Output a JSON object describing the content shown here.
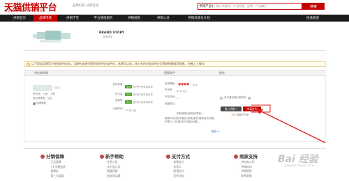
{
  "header": {
    "logo_cn": "天猫供销平台",
    "logo_en": "GONGXIAO.TMALL.COM",
    "slogan": "品牌好货 分销首选",
    "search_category": "供销产品",
    "search_placeholder": "输入关键字，产品标题、品牌、产品编号",
    "search_button": "搜索"
  },
  "nav": {
    "items": [
      "供销首页",
      "品牌市场",
      "供销学堂",
      "平台增值服务",
      "供销规则",
      "供销入驻",
      "供销商成长计划"
    ],
    "active_index": 1,
    "right_link": "快速通道"
  },
  "store": {
    "title": "BRAND STORY",
    "subtitle": "品牌故事"
  },
  "notice": {
    "text": "以下是该品牌官方授权的供应商，当期有关键分销资质的供应商合作，选择可以的...线上布供应面对供应可直接到微推荐销售，完善之上操作"
  },
  "table": {
    "headers": [
      "供应商明细",
      "",
      "招募条件",
      "操作"
    ],
    "supplier": {
      "location": "所在地：上海，上海",
      "brand_type": "供应商类型：企业",
      "badge": "品牌旗舰"
    },
    "stats": [
      {
        "label": "供货质量：",
        "tag": "5.0",
        "note": "低于行业平均水平"
      },
      {
        "label": "成交量：",
        "tag": "5.0",
        "note": "低于行业平均水平"
      },
      {
        "label": "退款率：",
        "tag": "5.0",
        "note": "低于行业平均水平"
      },
      {
        "label": "分销时间：",
        "tag": "",
        "note": "1个月 6天"
      }
    ],
    "requirements": {
      "level_label": "信用等级：",
      "level_hearts": "♥♥♥♥",
      "level_note": "以上",
      "rate_label": "好评率：",
      "rate_value": "97% 以上",
      "open_label": "开店时间：",
      "open_value": "—",
      "region_label": "经营类目：",
      "region_value": "奶粉/辅食/营养品/零食/...",
      "more": "服饰/内衣/配件/鞋包/家装/家纺/居家百货/美容护理/个人护理/洗护/母婴/玩具/...",
      "more_link": "更多>>"
    },
    "action": {
      "checkbox_label": "未开通天猫分销供货",
      "apply_button": "进入供销 »",
      "cooperate_button": "申请合作",
      "stat_number": "105",
      "stat_label": "待我开产品"
    }
  },
  "footer": {
    "columns": [
      {
        "title": "分销保障",
        "items": [
          "正品保障",
          "7天无理由退",
          "保障金",
          "第三方监管"
        ]
      },
      {
        "title": "新手帮助",
        "items": [
          "注册入驻",
          "支付宝认证",
          "我要招募",
          "找优质品牌"
        ]
      },
      {
        "title": "支付方式",
        "items": [
          "快捷支付",
          "信用卡",
          "网银支付",
          "货到付款"
        ]
      },
      {
        "title": "商家支持",
        "items": [
          "供应商入驻",
          "供销培训",
          "供销规则",
          "联系客服"
        ]
      }
    ]
  },
  "watermark": {
    "text": "Bai 经验",
    "sub": "jingyan.baidu.com"
  },
  "colors": {
    "accent": "#c40000",
    "nav_bg": "#1c1c1c",
    "tag_green": "#52a52a"
  }
}
